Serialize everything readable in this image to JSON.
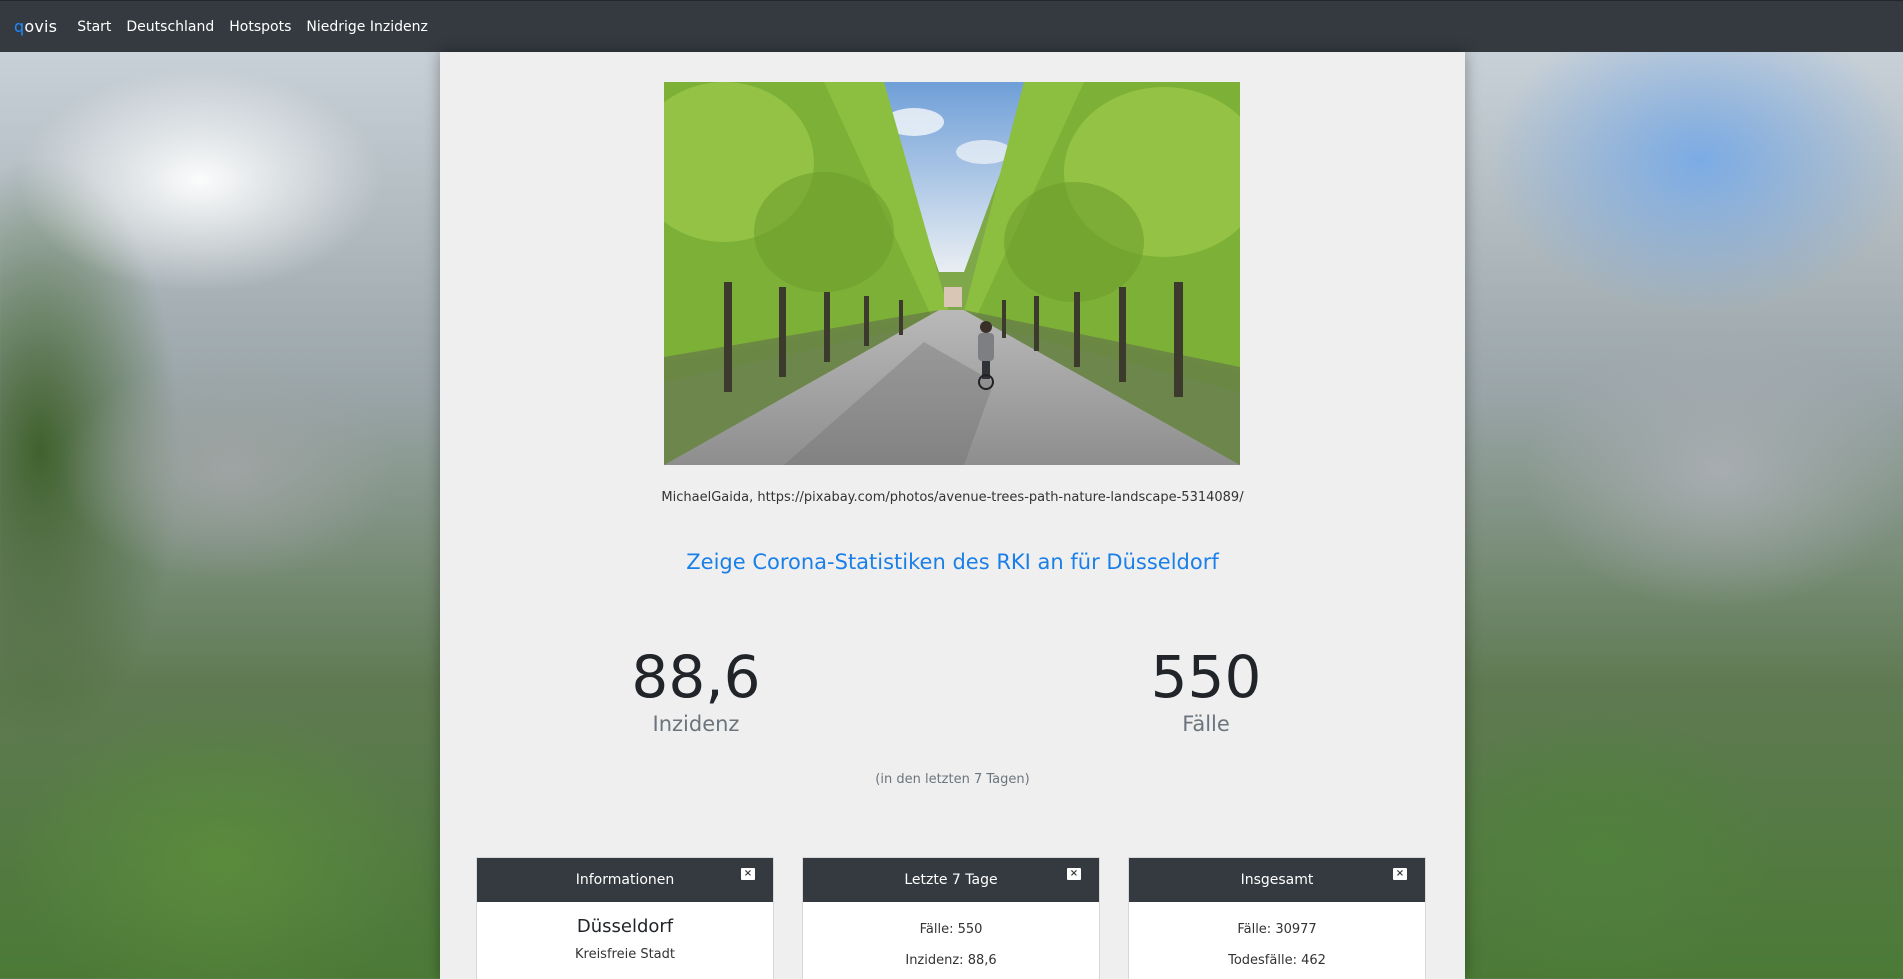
{
  "nav": {
    "brand_q": "q",
    "brand_rest": "ovis",
    "items": [
      "Start",
      "Deutschland",
      "Hotspots",
      "Niedrige Inzidenz"
    ]
  },
  "photo": {
    "credit": "MichaelGaida, https://pixabay.com/photos/avenue-trees-path-nature-landscape-5314089/"
  },
  "headline": "Zeige Corona-Statistiken des RKI an für Düsseldorf",
  "stats": {
    "incidence_value": "88,6",
    "incidence_label": "Inzidenz",
    "cases_value": "550",
    "cases_label": "Fälle",
    "note": "(in den letzten 7 Tagen)"
  },
  "cards": {
    "info": {
      "title": "Informationen",
      "city": "Düsseldorf",
      "type": "Kreisfreie Stadt"
    },
    "week": {
      "title": "Letzte 7 Tage",
      "cases": "Fälle: 550",
      "incidence": "Inzidenz: 88,6"
    },
    "total": {
      "title": "Insgesamt",
      "cases": "Fälle: 30977",
      "deaths": "Todesfälle: 462"
    },
    "close_symbol": "×"
  },
  "colors": {
    "navbar": "#343a40",
    "accent": "#1a7fe8",
    "panel": "#efefef"
  }
}
